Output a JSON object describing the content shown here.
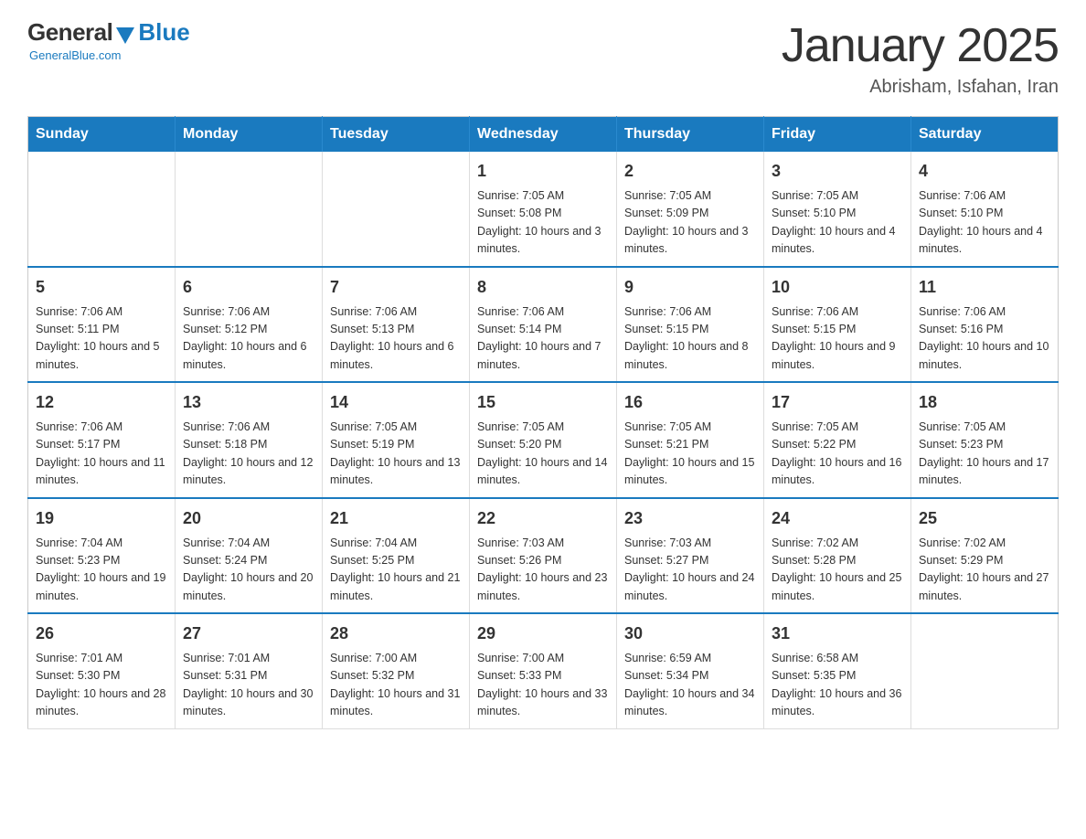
{
  "logo": {
    "general": "General",
    "blue": "Blue",
    "tagline": "GeneralBlue.com"
  },
  "title": "January 2025",
  "subtitle": "Abrisham, Isfahan, Iran",
  "days_of_week": [
    "Sunday",
    "Monday",
    "Tuesday",
    "Wednesday",
    "Thursday",
    "Friday",
    "Saturday"
  ],
  "weeks": [
    {
      "days": [
        {
          "number": "",
          "info": ""
        },
        {
          "number": "",
          "info": ""
        },
        {
          "number": "",
          "info": ""
        },
        {
          "number": "1",
          "info": "Sunrise: 7:05 AM\nSunset: 5:08 PM\nDaylight: 10 hours and 3 minutes."
        },
        {
          "number": "2",
          "info": "Sunrise: 7:05 AM\nSunset: 5:09 PM\nDaylight: 10 hours and 3 minutes."
        },
        {
          "number": "3",
          "info": "Sunrise: 7:05 AM\nSunset: 5:10 PM\nDaylight: 10 hours and 4 minutes."
        },
        {
          "number": "4",
          "info": "Sunrise: 7:06 AM\nSunset: 5:10 PM\nDaylight: 10 hours and 4 minutes."
        }
      ]
    },
    {
      "days": [
        {
          "number": "5",
          "info": "Sunrise: 7:06 AM\nSunset: 5:11 PM\nDaylight: 10 hours and 5 minutes."
        },
        {
          "number": "6",
          "info": "Sunrise: 7:06 AM\nSunset: 5:12 PM\nDaylight: 10 hours and 6 minutes."
        },
        {
          "number": "7",
          "info": "Sunrise: 7:06 AM\nSunset: 5:13 PM\nDaylight: 10 hours and 6 minutes."
        },
        {
          "number": "8",
          "info": "Sunrise: 7:06 AM\nSunset: 5:14 PM\nDaylight: 10 hours and 7 minutes."
        },
        {
          "number": "9",
          "info": "Sunrise: 7:06 AM\nSunset: 5:15 PM\nDaylight: 10 hours and 8 minutes."
        },
        {
          "number": "10",
          "info": "Sunrise: 7:06 AM\nSunset: 5:15 PM\nDaylight: 10 hours and 9 minutes."
        },
        {
          "number": "11",
          "info": "Sunrise: 7:06 AM\nSunset: 5:16 PM\nDaylight: 10 hours and 10 minutes."
        }
      ]
    },
    {
      "days": [
        {
          "number": "12",
          "info": "Sunrise: 7:06 AM\nSunset: 5:17 PM\nDaylight: 10 hours and 11 minutes."
        },
        {
          "number": "13",
          "info": "Sunrise: 7:06 AM\nSunset: 5:18 PM\nDaylight: 10 hours and 12 minutes."
        },
        {
          "number": "14",
          "info": "Sunrise: 7:05 AM\nSunset: 5:19 PM\nDaylight: 10 hours and 13 minutes."
        },
        {
          "number": "15",
          "info": "Sunrise: 7:05 AM\nSunset: 5:20 PM\nDaylight: 10 hours and 14 minutes."
        },
        {
          "number": "16",
          "info": "Sunrise: 7:05 AM\nSunset: 5:21 PM\nDaylight: 10 hours and 15 minutes."
        },
        {
          "number": "17",
          "info": "Sunrise: 7:05 AM\nSunset: 5:22 PM\nDaylight: 10 hours and 16 minutes."
        },
        {
          "number": "18",
          "info": "Sunrise: 7:05 AM\nSunset: 5:23 PM\nDaylight: 10 hours and 17 minutes."
        }
      ]
    },
    {
      "days": [
        {
          "number": "19",
          "info": "Sunrise: 7:04 AM\nSunset: 5:23 PM\nDaylight: 10 hours and 19 minutes."
        },
        {
          "number": "20",
          "info": "Sunrise: 7:04 AM\nSunset: 5:24 PM\nDaylight: 10 hours and 20 minutes."
        },
        {
          "number": "21",
          "info": "Sunrise: 7:04 AM\nSunset: 5:25 PM\nDaylight: 10 hours and 21 minutes."
        },
        {
          "number": "22",
          "info": "Sunrise: 7:03 AM\nSunset: 5:26 PM\nDaylight: 10 hours and 23 minutes."
        },
        {
          "number": "23",
          "info": "Sunrise: 7:03 AM\nSunset: 5:27 PM\nDaylight: 10 hours and 24 minutes."
        },
        {
          "number": "24",
          "info": "Sunrise: 7:02 AM\nSunset: 5:28 PM\nDaylight: 10 hours and 25 minutes."
        },
        {
          "number": "25",
          "info": "Sunrise: 7:02 AM\nSunset: 5:29 PM\nDaylight: 10 hours and 27 minutes."
        }
      ]
    },
    {
      "days": [
        {
          "number": "26",
          "info": "Sunrise: 7:01 AM\nSunset: 5:30 PM\nDaylight: 10 hours and 28 minutes."
        },
        {
          "number": "27",
          "info": "Sunrise: 7:01 AM\nSunset: 5:31 PM\nDaylight: 10 hours and 30 minutes."
        },
        {
          "number": "28",
          "info": "Sunrise: 7:00 AM\nSunset: 5:32 PM\nDaylight: 10 hours and 31 minutes."
        },
        {
          "number": "29",
          "info": "Sunrise: 7:00 AM\nSunset: 5:33 PM\nDaylight: 10 hours and 33 minutes."
        },
        {
          "number": "30",
          "info": "Sunrise: 6:59 AM\nSunset: 5:34 PM\nDaylight: 10 hours and 34 minutes."
        },
        {
          "number": "31",
          "info": "Sunrise: 6:58 AM\nSunset: 5:35 PM\nDaylight: 10 hours and 36 minutes."
        },
        {
          "number": "",
          "info": ""
        }
      ]
    }
  ]
}
